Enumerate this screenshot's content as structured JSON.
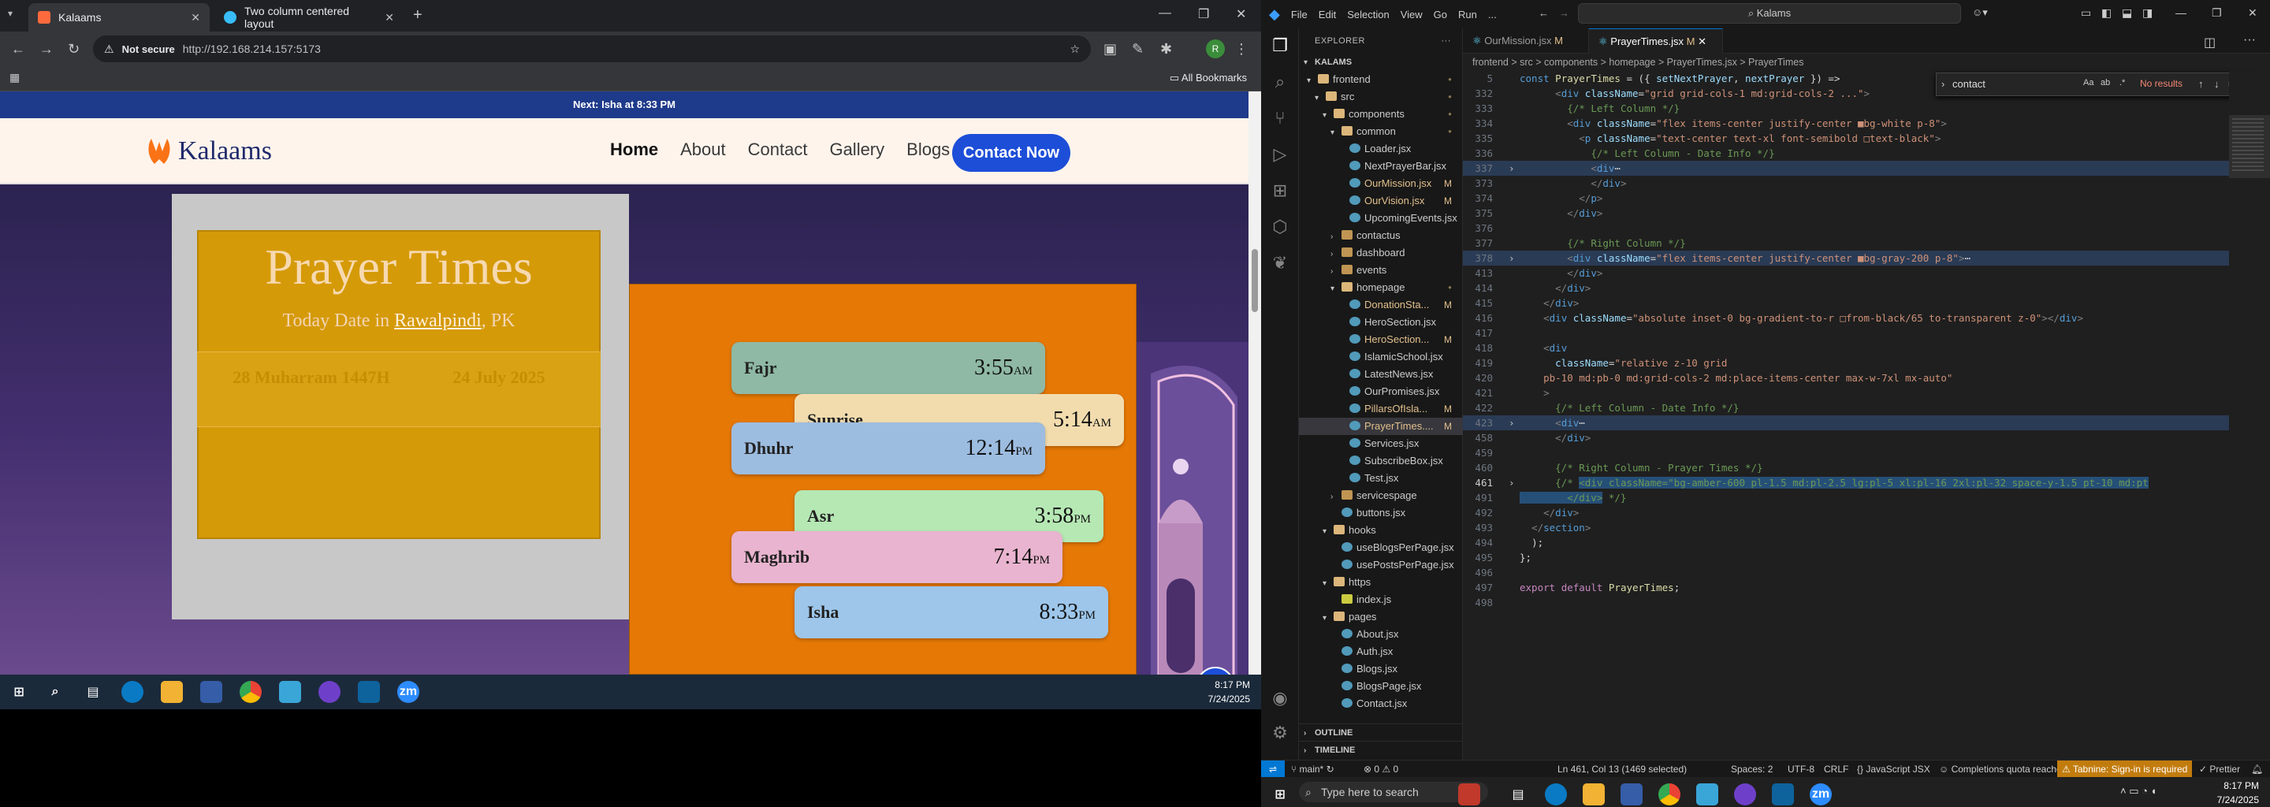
{
  "browser": {
    "tabs": [
      {
        "label": "Kalaams",
        "active": true
      },
      {
        "label": "Two column centered layout",
        "active": false
      }
    ],
    "new_tab": "+",
    "not_secure": "Not secure",
    "url": "http://192.168.214.157:5173",
    "all_bookmarks": "All Bookmarks",
    "profile_initial": "R"
  },
  "site": {
    "topbar": "Next: Isha at 8:33 PM",
    "logo": "Kalaams",
    "nav": [
      "Home",
      "About",
      "Contact",
      "Gallery",
      "Blogs"
    ],
    "contact_btn": "Contact Now",
    "title": "Prayer Times",
    "subtitle_prefix": "Today Date in ",
    "city": "Rawalpindi",
    "country": ", PK",
    "hijri_date": "28 Muharram 1447H",
    "greg_date": "24 July 2025",
    "prayers": [
      {
        "name": "Fajr",
        "time": "3:55",
        "ampm": "AM",
        "color": "#8fb9a5"
      },
      {
        "name": "Sunrise",
        "time": "5:14",
        "ampm": "AM",
        "color": "#f2dcae"
      },
      {
        "name": "Dhuhr",
        "time": "12:14",
        "ampm": "PM",
        "color": "#9dbde0"
      },
      {
        "name": "Asr",
        "time": "3:58",
        "ampm": "PM",
        "color": "#b6e8b4"
      },
      {
        "name": "Maghrib",
        "time": "7:14",
        "ampm": "PM",
        "color": "#e9b4cf"
      },
      {
        "name": "Isha",
        "time": "8:33",
        "ampm": "PM",
        "color": "#9dc6ea"
      }
    ]
  },
  "taskbar1": {
    "time": "8:17 PM",
    "date": "7/24/2025"
  },
  "vscode": {
    "menu": [
      "File",
      "Edit",
      "Selection",
      "View",
      "Go",
      "Run",
      "..."
    ],
    "search": "Kalams",
    "explorer_title": "EXPLORER",
    "root": "KALAMS",
    "tree": [
      {
        "d": 1,
        "type": "folder",
        "open": true,
        "label": "frontend",
        "badge": "dot"
      },
      {
        "d": 2,
        "type": "folder",
        "open": true,
        "label": "src",
        "badge": "dot"
      },
      {
        "d": 3,
        "type": "folder",
        "open": true,
        "label": "components",
        "badge": "dot"
      },
      {
        "d": 4,
        "type": "folder",
        "open": true,
        "label": "common",
        "badge": "dot"
      },
      {
        "d": 5,
        "type": "file",
        "label": "Loader.jsx"
      },
      {
        "d": 5,
        "type": "file",
        "label": "NextPrayerBar.jsx"
      },
      {
        "d": 5,
        "type": "file",
        "label": "OurMission.jsx",
        "badge": "M",
        "mod": true
      },
      {
        "d": 5,
        "type": "file",
        "label": "OurVision.jsx",
        "badge": "M",
        "mod": true
      },
      {
        "d": 5,
        "type": "file",
        "label": "UpcomingEvents.jsx"
      },
      {
        "d": 4,
        "type": "folder",
        "open": false,
        "label": "contactus"
      },
      {
        "d": 4,
        "type": "folder",
        "open": false,
        "label": "dashboard"
      },
      {
        "d": 4,
        "type": "folder",
        "open": false,
        "label": "events"
      },
      {
        "d": 4,
        "type": "folder",
        "open": true,
        "label": "homepage",
        "badge": "dot"
      },
      {
        "d": 5,
        "type": "file",
        "label": "DonationSta...",
        "badge": "M",
        "mod": true
      },
      {
        "d": 5,
        "type": "file",
        "label": "HeroSection.jsx"
      },
      {
        "d": 5,
        "type": "file",
        "label": "HeroSection...",
        "badge": "M",
        "mod": true
      },
      {
        "d": 5,
        "type": "file",
        "label": "IslamicSchool.jsx"
      },
      {
        "d": 5,
        "type": "file",
        "label": "LatestNews.jsx"
      },
      {
        "d": 5,
        "type": "file",
        "label": "OurPromises.jsx"
      },
      {
        "d": 5,
        "type": "file",
        "label": "PillarsOfIsla...",
        "badge": "M",
        "mod": true
      },
      {
        "d": 5,
        "type": "file",
        "label": "PrayerTimes....",
        "badge": "M",
        "mod": true,
        "sel": true
      },
      {
        "d": 5,
        "type": "file",
        "label": "Services.jsx"
      },
      {
        "d": 5,
        "type": "file",
        "label": "SubscribeBox.jsx"
      },
      {
        "d": 5,
        "type": "file",
        "label": "Test.jsx"
      },
      {
        "d": 4,
        "type": "folder",
        "open": false,
        "label": "servicespage"
      },
      {
        "d": 4,
        "type": "file",
        "label": "buttons.jsx"
      },
      {
        "d": 3,
        "type": "folder",
        "open": true,
        "label": "hooks"
      },
      {
        "d": 4,
        "type": "file",
        "label": "useBlogsPerPage.jsx"
      },
      {
        "d": 4,
        "type": "file",
        "label": "usePostsPerPage.jsx"
      },
      {
        "d": 3,
        "type": "folder",
        "open": true,
        "label": "https"
      },
      {
        "d": 4,
        "type": "file",
        "label": "index.js"
      },
      {
        "d": 3,
        "type": "folder",
        "open": true,
        "label": "pages"
      },
      {
        "d": 4,
        "type": "file",
        "label": "About.jsx"
      },
      {
        "d": 4,
        "type": "file",
        "label": "Auth.jsx"
      },
      {
        "d": 4,
        "type": "file",
        "label": "Blogs.jsx"
      },
      {
        "d": 4,
        "type": "file",
        "label": "BlogsPage.jsx"
      },
      {
        "d": 4,
        "type": "file",
        "label": "Contact.jsx"
      }
    ],
    "outline": "OUTLINE",
    "timeline": "TIMELINE",
    "tabs": [
      {
        "label": "OurMission.jsx",
        "badge": "M",
        "active": false
      },
      {
        "label": "PrayerTimes.jsx",
        "badge": "M",
        "active": true
      }
    ],
    "breadcrumb": "frontend > src > components > homepage > PrayerTimes.jsx > PrayerTimes",
    "find_query": "contact",
    "find_result": "No results",
    "lines": [
      {
        "n": "5",
        "fold": false,
        "html": "<span class='k'>const</span> <span class='f'>PrayerTimes</span> <span class='w'>= ({</span> <span class='a'>setNextPrayer</span><span class='w'>,</span> <span class='a'>nextPrayer</span> <span class='w'>}) =&gt;</span>"
      },
      {
        "n": "332",
        "html": "      <span class='p'>&lt;</span><span class='k'>div</span> <span class='a'>className</span><span class='w'>=</span><span class='s'>\"grid grid-cols-1 md:grid-cols-2 ...\"</span><span class='p'>&gt;</span>"
      },
      {
        "n": "333",
        "html": "        <span class='c'>{/* Left Column */}</span>"
      },
      {
        "n": "334",
        "html": "        <span class='p'>&lt;</span><span class='k'>div</span> <span class='a'>className</span><span class='w'>=</span><span class='s'>\"flex items-center justify-center ■bg-white p-8\"</span><span class='p'>&gt;</span>"
      },
      {
        "n": "335",
        "html": "          <span class='p'>&lt;</span><span class='k'>p</span> <span class='a'>className</span><span class='w'>=</span><span class='s'>\"text-center text-xl font-semibold □text-black\"</span><span class='p'>&gt;</span>"
      },
      {
        "n": "336",
        "html": "            <span class='c'>{/* Left Column - Date Info */}</span>"
      },
      {
        "n": "337",
        "fold": true,
        "html": "            <span class='p'>&lt;</span><span class='k'>div</span><span class='w'>⋯</span>",
        "hl": true
      },
      {
        "n": "373",
        "html": "            <span class='p'>&lt;/</span><span class='k'>div</span><span class='p'>&gt;</span>"
      },
      {
        "n": "374",
        "html": "          <span class='p'>&lt;/</span><span class='k'>p</span><span class='p'>&gt;</span>"
      },
      {
        "n": "375",
        "html": "        <span class='p'>&lt;/</span><span class='k'>div</span><span class='p'>&gt;</span>"
      },
      {
        "n": "376",
        "html": ""
      },
      {
        "n": "377",
        "html": "        <span class='c'>{/* Right Column */}</span>"
      },
      {
        "n": "378",
        "fold": true,
        "html": "        <span class='p'>&lt;</span><span class='k'>div</span> <span class='a'>className</span><span class='w'>=</span><span class='s'>\"flex items-center justify-center ■bg-gray-200 p-8\"</span><span class='p'>&gt;</span><span class='w'>⋯</span>",
        "hl": true
      },
      {
        "n": "413",
        "html": "        <span class='p'>&lt;/</span><span class='k'>div</span><span class='p'>&gt;</span>"
      },
      {
        "n": "414",
        "html": "      <span class='p'>&lt;/</span><span class='k'>div</span><span class='p'>&gt;</span>"
      },
      {
        "n": "415",
        "html": "    <span class='p'>&lt;/</span><span class='k'>div</span><span class='p'>&gt;</span>"
      },
      {
        "n": "416",
        "html": "    <span class='p'>&lt;</span><span class='k'>div</span> <span class='a'>className</span><span class='w'>=</span><span class='s'>\"absolute inset-0 bg-gradient-to-r □from-black/65 to-transparent z-0\"</span><span class='p'>&gt;&lt;/</span><span class='k'>div</span><span class='p'>&gt;</span>"
      },
      {
        "n": "417",
        "html": ""
      },
      {
        "n": "418",
        "html": "    <span class='p'>&lt;</span><span class='k'>div</span>"
      },
      {
        "n": "419",
        "html": "      <span class='a'>className</span><span class='w'>=</span><span class='s'>\"relative z-10 grid</span>"
      },
      {
        "n": "420",
        "html": "<span class='s'>    pb-10 md:pb-0 md:grid-cols-2 md:place-items-center max-w-7xl mx-auto\"</span>"
      },
      {
        "n": "421",
        "html": "    <span class='p'>&gt;</span>"
      },
      {
        "n": "422",
        "html": "      <span class='c'>{/* Left Column - Date Info */}</span>"
      },
      {
        "n": "423",
        "fold": true,
        "html": "      <span class='p'>&lt;</span><span class='k'>div</span><span class='w'>⋯</span>",
        "hl": true
      },
      {
        "n": "458",
        "html": "      <span class='p'>&lt;/</span><span class='k'>div</span><span class='p'>&gt;</span>"
      },
      {
        "n": "459",
        "html": ""
      },
      {
        "n": "460",
        "html": "      <span class='c'>{/* Right Column - Prayer Times */}</span>"
      },
      {
        "n": "461",
        "fold": true,
        "cur": true,
        "html": "      <span class='c'>{/* <span style=\"background:#264f78\">&lt;div className=\"bg-amber-600 pl-1.5 md:pl-2.5 lg:pl-5 xl:pl-16 2xl:pl-32 space-y-1.5 pt-10 md:pt</span></span>"
      },
      {
        "n": "491",
        "html": "<span class='c'><span style=\"background:#264f78\">        &lt;/div&gt;</span> */}</span>"
      },
      {
        "n": "492",
        "html": "    <span class='p'>&lt;/</span><span class='k'>div</span><span class='p'>&gt;</span>"
      },
      {
        "n": "493",
        "html": "  <span class='p'>&lt;/</span><span class='k'>section</span><span class='p'>&gt;</span>"
      },
      {
        "n": "494",
        "html": "  <span class='w'>);</span>"
      },
      {
        "n": "495",
        "html": "<span class='w'>};</span>"
      },
      {
        "n": "496",
        "html": ""
      },
      {
        "n": "497",
        "html": "<span class='kw'>export</span> <span class='kw'>default</span> <span class='f'>PrayerTimes</span><span class='w'>;</span>"
      },
      {
        "n": "498",
        "html": ""
      }
    ],
    "status": {
      "branch": "main*",
      "errors": "⊗ 0 ⚠ 0",
      "position": "Ln 461, Col 13 (1469 selected)",
      "spaces": "Spaces: 2",
      "encoding": "UTF-8",
      "eol": "CRLF",
      "language": "JavaScript JSX",
      "quota": "Completions quota reached",
      "tabnine": "Tabnine: Sign-in is required",
      "prettier": "✓ Prettier"
    }
  },
  "taskbar2": {
    "search": "Type here to search",
    "time": "8:17 PM",
    "date": "7/24/2025"
  },
  "colors": {
    "accent": "#0078d4",
    "brand": "#1d4ed8",
    "amber": "#d59a08",
    "orange": "#e67805"
  }
}
